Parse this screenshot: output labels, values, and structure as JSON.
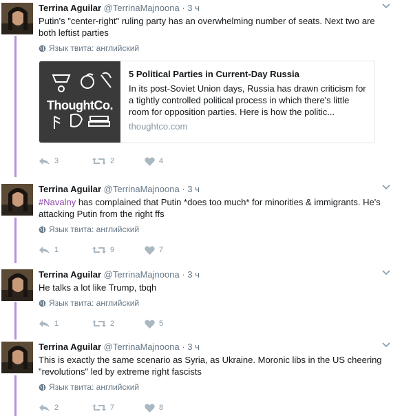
{
  "tweets": [
    {
      "name": "Terrina Aguilar",
      "handle": "@TerrinaMajnoona",
      "sep": "·",
      "time": "3 ч",
      "text": "Putin's \"center-right\" ruling party has an overwhelming number of seats. Next two are both leftist parties",
      "lang": "Язык твита: английский",
      "card": {
        "title": "5 Political Parties in Current-Day Russia",
        "description": "In its post-Soviet Union days, Russia has drawn criticism for a tightly controlled political process in which there's little room for opposition parties. Here is how the politic...",
        "domain": "thoughtco.com",
        "logo": "ThoughtCo."
      },
      "replies": "3",
      "retweets": "2",
      "likes": "4"
    },
    {
      "name": "Terrina Aguilar",
      "handle": "@TerrinaMajnoona",
      "sep": "·",
      "time": "3 ч",
      "hashtag": "#Navalny",
      "text": " has complained that Putin *does too much* for minorities & immigrants. He's attacking Putin from the right ffs",
      "lang": "Язык твита: английский",
      "replies": "1",
      "retweets": "9",
      "likes": "7"
    },
    {
      "name": "Terrina Aguilar",
      "handle": "@TerrinaMajnoona",
      "sep": "·",
      "time": "3 ч",
      "text": "He talks a lot like Trump, tbqh",
      "lang": "Язык твита: английский",
      "replies": "1",
      "retweets": "2",
      "likes": "5"
    },
    {
      "name": "Terrina Aguilar",
      "handle": "@TerrinaMajnoona",
      "sep": "·",
      "time": "3 ч",
      "text": "This is exactly the same scenario as Syria, as Ukraine. Moronic libs in the US cheering \"revolutions\" led by extreme right fascists",
      "lang": "Язык твита: английский",
      "replies": "2",
      "retweets": "7",
      "likes": "8"
    }
  ],
  "colors": {
    "thread": "#b98ee0",
    "hashtag": "#8e44ad",
    "meta": "#657786"
  },
  "icons": [
    "avatar",
    "chevron-down-icon",
    "globe-icon",
    "reply-icon",
    "retweet-icon",
    "heart-icon"
  ]
}
